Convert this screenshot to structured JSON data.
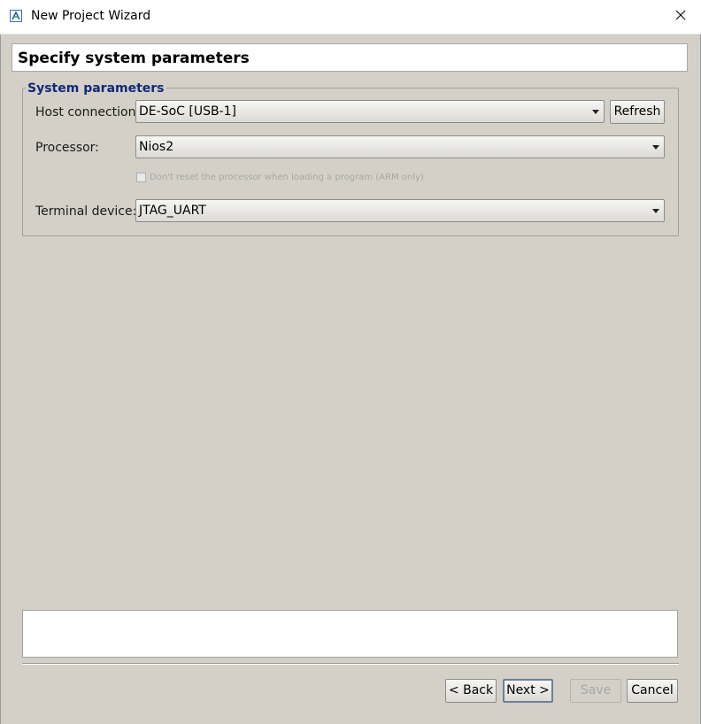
{
  "window": {
    "title": "New Project Wizard",
    "icons": {
      "app": "wizard-app-icon",
      "close": "close-icon"
    }
  },
  "header": {
    "title": "Specify system parameters"
  },
  "system_parameters": {
    "group_label": "System parameters",
    "host_connection": {
      "label": "Host connection:",
      "value": "DE-SoC [USB-1]"
    },
    "refresh_label": "Refresh",
    "processor": {
      "label": "Processor:",
      "value": "Nios2"
    },
    "reset_checkbox": {
      "label": "Don't reset the processor when loading a program (ARM only)",
      "checked": false,
      "enabled": false
    },
    "terminal_device": {
      "label": "Terminal device:",
      "value": "JTAG_UART"
    }
  },
  "message": {
    "text": ""
  },
  "buttons": {
    "back": "< Back",
    "next": "Next >",
    "save": "Save",
    "cancel": "Cancel"
  },
  "colors": {
    "background": "#d4d0c8",
    "group_label": "#102a78",
    "disabled_text": "#a6a6a6"
  }
}
